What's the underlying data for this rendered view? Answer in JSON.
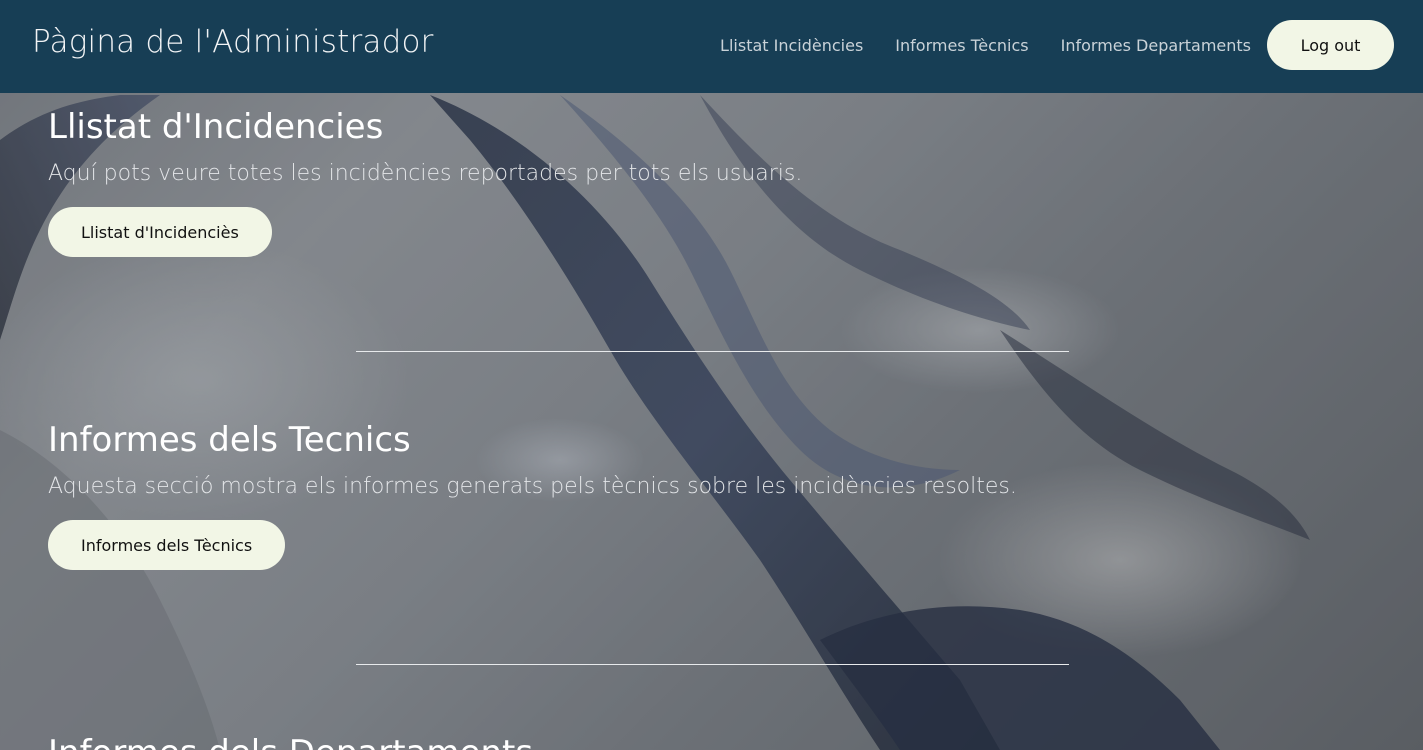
{
  "header": {
    "title": "Pàgina de l'Administrador",
    "nav": [
      {
        "label": "Llistat Incidències"
      },
      {
        "label": "Informes Tècnics"
      },
      {
        "label": "Informes Departaments"
      }
    ],
    "logout_label": "Log out"
  },
  "sections": [
    {
      "title": "Llistat d'Incidencies",
      "description": "Aquí pots veure totes les incidències reportades per tots els usuaris.",
      "button_label": "Llistat d'Incidenciès"
    },
    {
      "title": "Informes dels Tecnics",
      "description": "Aquesta secció mostra els informes generats pels tècnics sobre les incidències resoltes.",
      "button_label": "Informes dels Tècnics"
    },
    {
      "title": "Informes dels Departaments"
    }
  ],
  "colors": {
    "header_bg": "#173e55",
    "button_bg": "#f2f6e6",
    "heading_text": "#ffffff"
  }
}
